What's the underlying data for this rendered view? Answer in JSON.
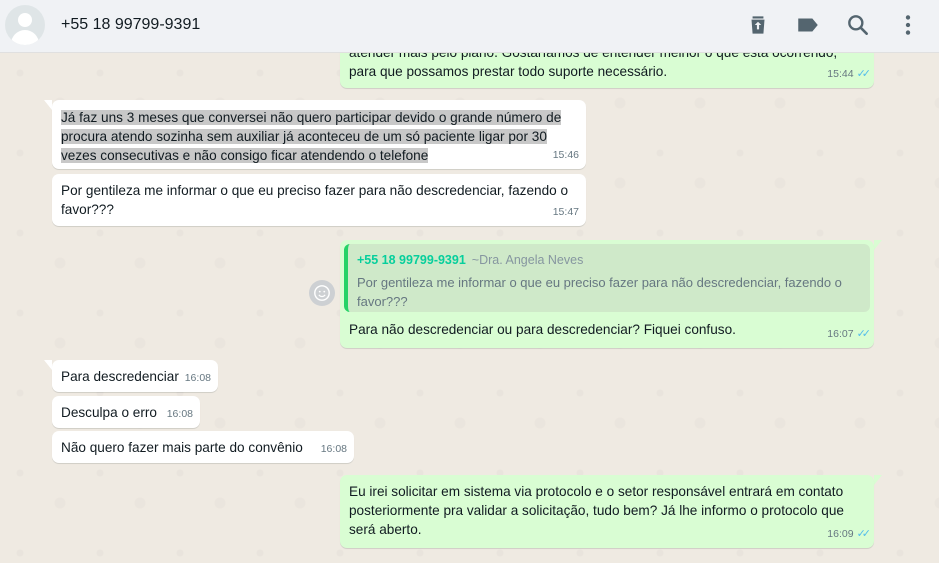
{
  "header": {
    "contact_name": "+55 18 99799-9391",
    "icons": [
      "delete-archive-icon",
      "label-tag-icon",
      "search-icon",
      "menu-dots-icon"
    ]
  },
  "messages": [
    {
      "direction": "out",
      "text": "atender mais pelo plano. Gostaríamos de entender melhor o que está ocorrendo,\npara que possamos prestar todo suporte necessário.",
      "time": "15:44",
      "status": "read"
    },
    {
      "direction": "in",
      "text": "Já faz uns 3 meses que conversei não quero participar devido o grande número de procura atendo sozinha sem auxiliar já aconteceu de um só paciente ligar por 30 vezes consecutivas e não consigo ficar atendendo o telefone",
      "time": "15:46",
      "selected": true
    },
    {
      "direction": "in",
      "text": "Por gentileza me informar o que eu preciso fazer para não descredenciar, fazendo o favor???",
      "time": "15:47"
    },
    {
      "direction": "out",
      "quote": {
        "author": "+55 18 99799-9391",
        "tag": "~Dra. Angela Neves",
        "text": "Por gentileza me informar o que eu preciso fazer para não descredenciar, fazendo o favor???"
      },
      "text": "Para não descredenciar ou para descredenciar? Fiquei confuso.",
      "time": "16:07",
      "status": "read"
    },
    {
      "direction": "in",
      "text": "Para descredenciar",
      "time": "16:08"
    },
    {
      "direction": "in",
      "text": "Desculpa o erro",
      "time": "16:08"
    },
    {
      "direction": "in",
      "text": "Não quero fazer mais parte do convênio",
      "time": "16:08"
    },
    {
      "direction": "out",
      "text": "Eu irei solicitar em sistema via protocolo e o setor responsável entrará em contato posteriormente pra validar a solicitação, tudo bem? Já lhe informo o protocolo que será aberto.",
      "time": "16:09",
      "status": "read"
    }
  ],
  "colors": {
    "incoming": "#ffffff",
    "outgoing": "#d9fdd3",
    "read_ticks": "#53bdeb",
    "quote_author": "#06cf9c",
    "chat_bg": "#efeae2"
  }
}
